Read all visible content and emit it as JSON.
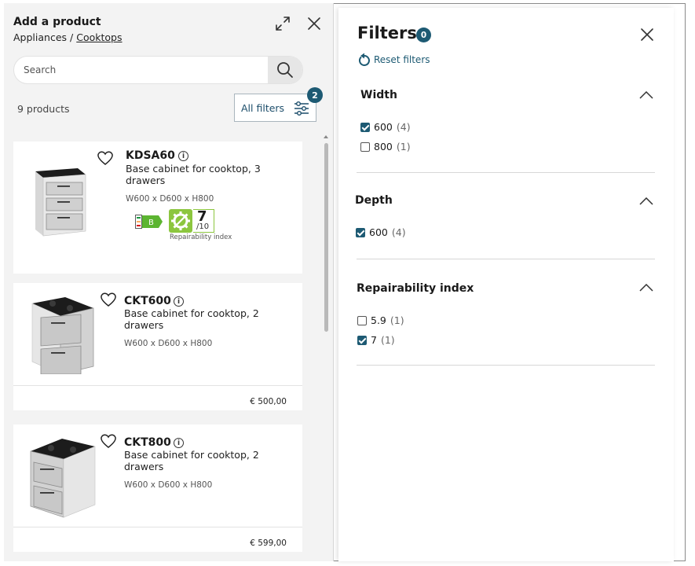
{
  "left_panel": {
    "title": "Add a product",
    "breadcrumb": {
      "parent": "Appliances",
      "separator": "/",
      "current": "Cooktops"
    },
    "search": {
      "placeholder": "Search",
      "value": ""
    },
    "product_count": "9 products",
    "all_filters": {
      "label": "All filters",
      "badge": "2"
    }
  },
  "products": [
    {
      "name": "KDSA60",
      "description": "Base cabinet for cooktop, 3 drawers",
      "dimensions": "W600 x D600 x H800",
      "energy_label": "B",
      "energy_scale": "A G",
      "repairability": {
        "score": "7",
        "max": "/10",
        "label": "Repairability index"
      }
    },
    {
      "name": "CKT600",
      "description": "Base cabinet for cooktop, 2 drawers",
      "dimensions": "W600 x D600 x H800",
      "price": "€ 500,00"
    },
    {
      "name": "CKT800",
      "description": "Base cabinet for cooktop, 2 drawers",
      "dimensions": "W600 x D600 x H800",
      "price": "€ 599,00"
    }
  ],
  "filters_panel": {
    "title": "Filters",
    "badge": "0",
    "reset_label": "Reset filters",
    "sections": [
      {
        "title": "Width",
        "options": [
          {
            "label": "600",
            "count": "(4)",
            "checked": true
          },
          {
            "label": "800",
            "count": "(1)",
            "checked": false
          }
        ]
      },
      {
        "title": "Depth",
        "options": [
          {
            "label": "600",
            "count": "(4)",
            "checked": true
          }
        ]
      },
      {
        "title": "Repairability index",
        "options": [
          {
            "label": "5.9",
            "count": "(1)",
            "checked": false
          },
          {
            "label": "7",
            "count": "(1)",
            "checked": true
          }
        ]
      }
    ]
  },
  "colors": {
    "accent": "#1d5a73",
    "energy_green": "#5cb531",
    "repair_green": "#8cc63f"
  },
  "icons": {
    "expand": "expand-arrows-icon",
    "close": "close-icon",
    "search": "search-icon",
    "filters": "sliders-icon",
    "favorite": "heart-icon",
    "info": "info-icon",
    "reset": "reset-arrow-icon",
    "collapse": "chevron-up-icon"
  }
}
